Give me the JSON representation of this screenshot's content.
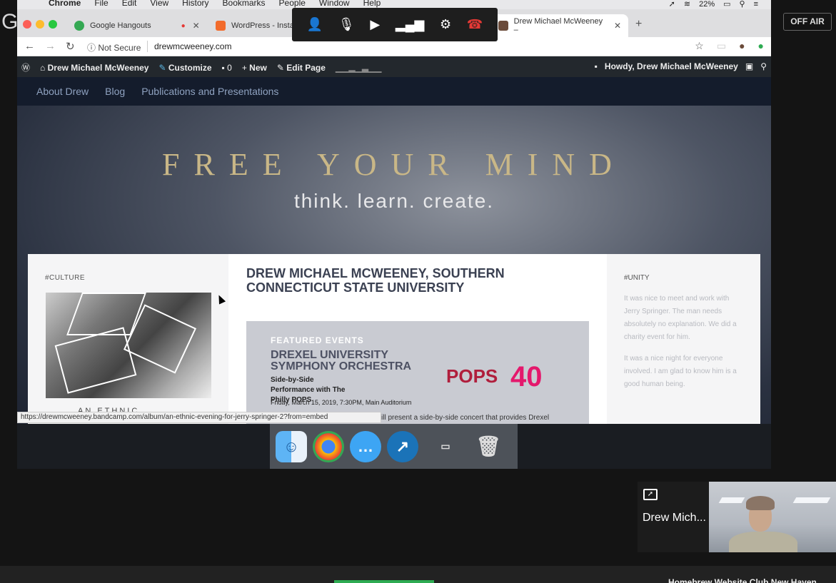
{
  "menubar": {
    "app": "Chrome",
    "menus": [
      "File",
      "Edit",
      "View",
      "History",
      "Bookmarks",
      "People",
      "Window",
      "Help"
    ],
    "battery": "22%"
  },
  "tabs": [
    {
      "label": "Google Hangouts",
      "icon": "hangouts-icon",
      "color": "#34a853"
    },
    {
      "label": "WordPress - Installatro",
      "icon": "wordpress-installatron-icon",
      "color": "#f26b2b"
    },
    {
      "label": "Drew Michael McWeeney –",
      "icon": "site-favicon",
      "color": "#6b4b3a"
    }
  ],
  "hangouts_toolbar": {
    "icons": [
      "add-person-icon",
      "mic-off-icon",
      "camera-off-icon",
      "signal-icon",
      "settings-icon",
      "hang-up-icon"
    ]
  },
  "address_bar": {
    "security": "Not Secure",
    "url": "drewmcweeney.com"
  },
  "wp_admin_bar": {
    "site_name": "Drew Michael McWeeney",
    "customize": "Customize",
    "comments": "0",
    "new": "New",
    "edit_page": "Edit Page",
    "howdy": "Howdy, Drew Michael McWeeney"
  },
  "site_nav": {
    "items": [
      "About Drew",
      "Blog",
      "Publications and Presentations"
    ]
  },
  "hero": {
    "title": "FREE YOUR MIND",
    "subtitle": "think. learn. create."
  },
  "left_column": {
    "tag": "#CULTURE",
    "caption": "AN ETHNIC"
  },
  "middle_column": {
    "post_title": "DREW MICHAEL MCWEENEY, SOUTHERN CONNECTICUT STATE UNIVERSITY",
    "poster": {
      "featured": "FEATURED EVENTS",
      "org": "DREXEL UNIVERSITY SYMPHONY ORCHESTRA",
      "performance": "Side-by-Side Performance with The Philly POPS",
      "date": "Friday, March 15, 2019, 7:30PM, Main Auditorium",
      "brand": "POPS",
      "brand_number": "40"
    }
  },
  "right_column": {
    "tag": "#UNITY",
    "paragraph1": "It was nice to meet and work with Jerry Springer. The man needs absolutely no explanation. We did a charity event for him.",
    "paragraph2": "It was a nice night for everyone involved. I am glad to know him is a good human being."
  },
  "status_bar": {
    "url": "https://drewmcweeney.bandcamp.com/album/an-ethnic-evening-for-jerry-springer-2?from=embed",
    "partial_text": "ill present a side-by-side concert that provides Drexel"
  },
  "dock": {
    "icons": [
      "finder-icon",
      "chrome-icon",
      "messages-icon",
      "airmail-icon",
      "chrome-window-icon",
      "trash-icon"
    ]
  },
  "hangouts": {
    "logo": "Google",
    "off_air": "OFF AIR",
    "participant_name": "Drew Mich...",
    "bottom_text": "Homebrew Website Club New Haven"
  }
}
